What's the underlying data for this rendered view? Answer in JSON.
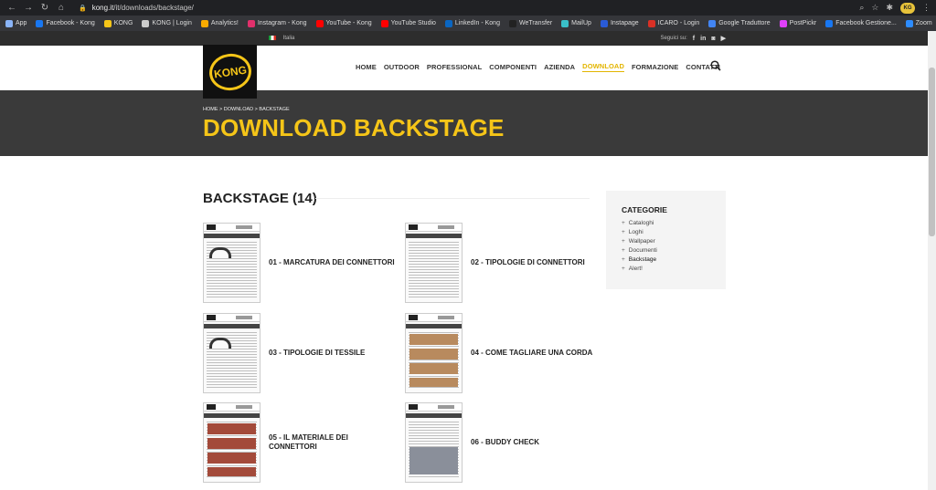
{
  "browser": {
    "url_host": "kong.it",
    "url_path": "/it/downloads/backstage/",
    "bookmarks": [
      {
        "label": "App",
        "color": "#8ab4f8"
      },
      {
        "label": "Facebook - Kong",
        "color": "#1877f2"
      },
      {
        "label": "KONG",
        "color": "#f5c518"
      },
      {
        "label": "KONG | Login",
        "color": "#cccccc"
      },
      {
        "label": "Analytics!",
        "color": "#f9ab00"
      },
      {
        "label": "Instagram - Kong",
        "color": "#e1306c"
      },
      {
        "label": "YouTube - Kong",
        "color": "#ff0000"
      },
      {
        "label": "YouTube Studio",
        "color": "#ff0000"
      },
      {
        "label": "LinkedIn - Kong",
        "color": "#0a66c2"
      },
      {
        "label": "WeTransfer",
        "color": "#222222"
      },
      {
        "label": "MailUp",
        "color": "#3ac0c9"
      },
      {
        "label": "Instapage",
        "color": "#2a5bd7"
      },
      {
        "label": "ICARO - Login",
        "color": "#d93025"
      },
      {
        "label": "Google Traduttore",
        "color": "#4285f4"
      },
      {
        "label": "PostPickr",
        "color": "#e040fb"
      },
      {
        "label": "Facebook Gestione...",
        "color": "#1877f2"
      },
      {
        "label": "Zoom",
        "color": "#2d8cff"
      }
    ]
  },
  "topbar": {
    "language": "Italia",
    "follow": "Seguici su:",
    "social": [
      "f",
      "in",
      "◙",
      "▶"
    ]
  },
  "logo": {
    "text": "KONG"
  },
  "nav": {
    "items": [
      {
        "label": "HOME"
      },
      {
        "label": "OUTDOOR"
      },
      {
        "label": "PROFESSIONAL"
      },
      {
        "label": "COMPONENTI"
      },
      {
        "label": "AZIENDA"
      },
      {
        "label": "DOWNLOAD",
        "active": true
      },
      {
        "label": "FORMAZIONE"
      },
      {
        "label": "CONTATTI"
      }
    ]
  },
  "hero": {
    "breadcrumb": "HOME  >  DOWNLOAD  >  BACKSTAGE",
    "title": "DOWNLOAD BACKSTAGE"
  },
  "main": {
    "section_title": "BACKSTAGE (14)",
    "items": [
      {
        "label": "01 - MARCATURA DEI CONNETTORI"
      },
      {
        "label": "02 - TIPOLOGIE DI CONNETTORI"
      },
      {
        "label": "03 - TIPOLOGIE DI TESSILE"
      },
      {
        "label": "04 - COME TAGLIARE UNA CORDA"
      },
      {
        "label": "05 - IL MATERIALE DEI CONNETTORI"
      },
      {
        "label": "06 - BUDDY CHECK"
      }
    ]
  },
  "sidebar": {
    "title": "CATEGORIE",
    "categories": [
      {
        "label": "Cataloghi"
      },
      {
        "label": "Loghi"
      },
      {
        "label": "Wallpaper"
      },
      {
        "label": "Documenti"
      },
      {
        "label": "Backstage",
        "active": true
      },
      {
        "label": "Alert!"
      }
    ]
  }
}
